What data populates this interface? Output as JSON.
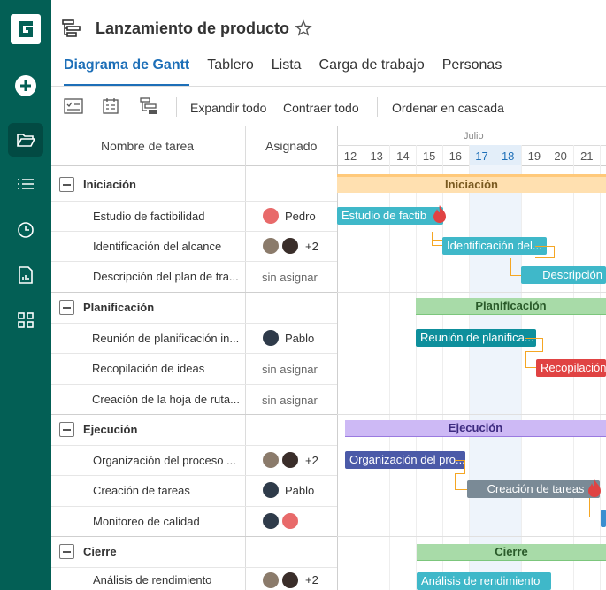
{
  "app": {
    "title": "Lanzamiento de producto"
  },
  "tabs": [
    "Diagrama de Gantt",
    "Tablero",
    "Lista",
    "Carga de trabajo",
    "Personas"
  ],
  "toolbar": {
    "expand": "Expandir todo",
    "collapse": "Contraer todo",
    "cascade": "Ordenar en cascada"
  },
  "grid": {
    "col_task": "Nombre de tarea",
    "col_assigned": "Asignado"
  },
  "timeline": {
    "month": "Julio",
    "days": [
      "12",
      "13",
      "14",
      "15",
      "16",
      "17",
      "18",
      "19",
      "20",
      "21"
    ],
    "highlight_days": [
      "17",
      "18"
    ]
  },
  "groups": [
    {
      "name": "Iniciación",
      "bar_label": "Iniciación",
      "tasks": [
        {
          "name": "Estudio de factibilidad",
          "assigned": "Pedro",
          "bar": "Estudio de factib"
        },
        {
          "name": "Identificación del alcance",
          "assigned": "+2",
          "bar": "Identificación del..."
        },
        {
          "name": "Descripción del plan de tra...",
          "assigned": "sin asignar",
          "bar": "Descripción"
        }
      ]
    },
    {
      "name": "Planificación",
      "bar_label": "Planificación",
      "tasks": [
        {
          "name": "Reunión de planificación in...",
          "assigned": "Pablo",
          "bar": "Reunión de planifica..."
        },
        {
          "name": "Recopilación de ideas",
          "assigned": "sin asignar",
          "bar": "Recopilación"
        },
        {
          "name": "Creación de la hoja de ruta...",
          "assigned": "sin asignar"
        }
      ]
    },
    {
      "name": "Ejecución",
      "bar_label": "Ejecución",
      "tasks": [
        {
          "name": "Organización del proceso ...",
          "assigned": "+2",
          "bar": "Organización del pro..."
        },
        {
          "name": "Creación de tareas",
          "assigned": "Pablo",
          "bar": "Creación de tareas"
        },
        {
          "name": "Monitoreo de calidad",
          "assigned": ""
        }
      ]
    },
    {
      "name": "Cierre",
      "bar_label": "Cierre",
      "tasks": [
        {
          "name": "Análisis de rendimiento",
          "assigned": "+2",
          "bar": "Análisis de rendimiento"
        }
      ]
    }
  ],
  "colors": {
    "sidebar": "#035f55",
    "accent": "#1d6fb8",
    "initiation": "#ffc97a",
    "planning": "#7cc67c",
    "execution": "#b89cf0",
    "task_teal": "#3fb8c9",
    "task_red": "#e04343",
    "task_indigo": "#4b5aa8",
    "task_gray": "#7a8a96",
    "connector": "#f5a623"
  }
}
